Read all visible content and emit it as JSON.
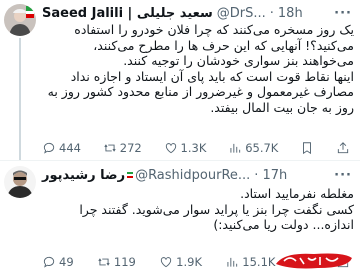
{
  "tweets": [
    {
      "name": "Saeed Jalili | سعید جلیلی",
      "handle": "@DrS...",
      "dot": "·",
      "time": "18h",
      "lines": [
        "یک روز مسخره می‌کنند که چرا فلان خودرو را استفاده",
        "می‌کنید؟! آنهایی که این حرف ها را مطرح می‌کنند،",
        "می‌خواهند بنز سواری خودشان را توجیه کنند.",
        "اینها نقاط قوت است که باید پای آن ایستاد و اجازه نداد",
        "مصارف غیرمعمول و غیرضرور از منابع محدود کشور روز به",
        "روز به جان بیت المال بیفتد."
      ],
      "actions": {
        "replies": "444",
        "reposts": "272",
        "likes": "1.3K",
        "views": "65.7K"
      }
    },
    {
      "name": "رضا رشیدپور",
      "handle": "@RashidpourRe...",
      "dot": "·",
      "time": "17h",
      "lines": [
        "مغلطه نفرمایید استاد.",
        "کسی نگفت چرا بنز یا پراید سوار می‌شوید. گفتند چرا",
        "اندازه... دولت ریا می‌کنید:)"
      ],
      "actions": {
        "replies": "49",
        "reposts": "119",
        "likes": "1.9K",
        "views": "15.1K"
      }
    }
  ],
  "more_label": "···",
  "icons": [
    "reply-icon",
    "repost-icon",
    "like-icon",
    "views-icon",
    "bookmark-icon",
    "share-icon"
  ],
  "colors": {
    "muted": "#536471",
    "divider": "#eff3f4",
    "logo_red": "#d7141a"
  }
}
